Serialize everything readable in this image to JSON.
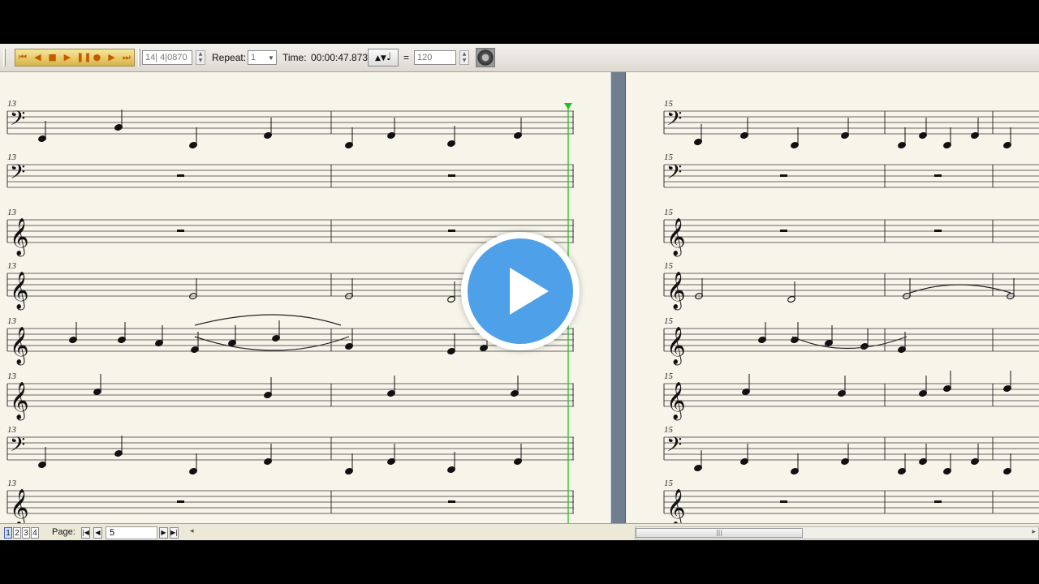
{
  "toolbar": {
    "transport_icons": [
      "rewind-to-start-icon",
      "rewind-icon",
      "stop-icon",
      "play-icon",
      "pause-icon",
      "record-icon",
      "fast-forward-icon",
      "forward-to-end-icon"
    ],
    "position_value": "14| 4|0870",
    "repeat_label": "Repeat:",
    "repeat_value": "1",
    "time_label": "Time:",
    "time_value": "00:00:47.873",
    "tempo_note_glyph": "♩",
    "equals_label": "=",
    "tempo_value": "120"
  },
  "score": {
    "left_measure_number": "13",
    "right_measure_number": "15",
    "staves": [
      {
        "clef": "bass"
      },
      {
        "clef": "bass"
      },
      {
        "clef": "treble"
      },
      {
        "clef": "treble"
      },
      {
        "clef": "treble"
      },
      {
        "clef": "treble"
      },
      {
        "clef": "bass"
      },
      {
        "clef": "treble"
      }
    ],
    "colors": {
      "playhead": "#21c021",
      "paper": "#f7f5ea",
      "ink": "#111111"
    }
  },
  "statusbar": {
    "page_tabs": [
      "1",
      "2",
      "3",
      "4"
    ],
    "active_tab": "1",
    "page_label": "Page:",
    "page_value": "5"
  },
  "video_overlay": {
    "icon": "play-button-icon",
    "accent": "#4ea1e8"
  }
}
